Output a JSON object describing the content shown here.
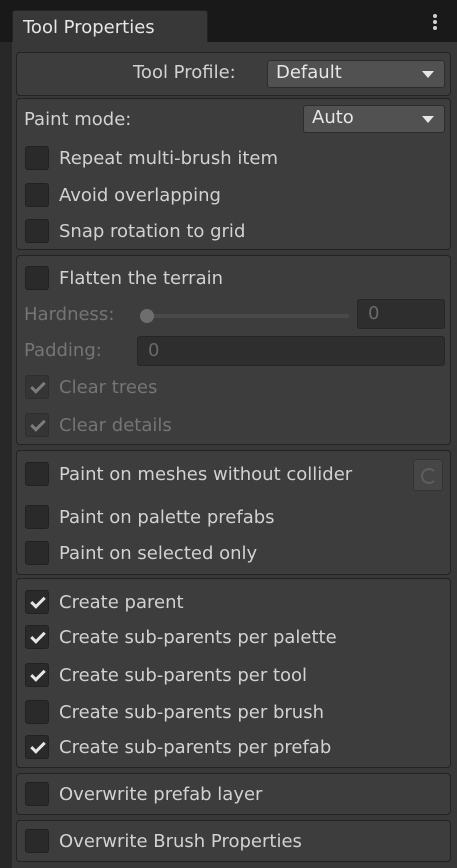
{
  "window": {
    "tab_title": "Tool Properties",
    "menu_icon": "vertical-dots-icon"
  },
  "profile": {
    "label": "Tool Profile:",
    "value": "Default"
  },
  "paint_group": {
    "mode_label": "Paint mode:",
    "mode_value": "Auto",
    "options": [
      {
        "label": "Repeat multi-brush item",
        "checked": false
      },
      {
        "label": "Avoid overlapping",
        "checked": false
      },
      {
        "label": "Snap rotation to grid",
        "checked": false
      }
    ]
  },
  "terrain_group": {
    "flatten_label": "Flatten the terrain",
    "flatten_checked": false,
    "hardness_label": "Hardness:",
    "hardness_value": "0",
    "padding_label": "Padding:",
    "padding_value": "0",
    "clear_trees_label": "Clear trees",
    "clear_trees_checked": true,
    "clear_details_label": "Clear details",
    "clear_details_checked": true
  },
  "mesh_group": {
    "options": [
      {
        "label": "Paint on meshes without collider",
        "checked": false
      },
      {
        "label": "Paint on palette prefabs",
        "checked": false
      },
      {
        "label": "Paint on selected only",
        "checked": false
      }
    ],
    "refresh_icon": "refresh-icon"
  },
  "parent_group": {
    "options": [
      {
        "label": "Create parent",
        "checked": true
      },
      {
        "label": "Create sub-parents per palette",
        "checked": true
      },
      {
        "label": "Create sub-parents per tool",
        "checked": true
      },
      {
        "label": "Create sub-parents per brush",
        "checked": false
      },
      {
        "label": "Create sub-parents per prefab",
        "checked": true
      }
    ]
  },
  "layer_group": {
    "label": "Overwrite prefab layer",
    "checked": false
  },
  "brush_group": {
    "label": "Overwrite Brush Properties",
    "checked": false
  },
  "colors": {
    "background": "#383838",
    "group_background": "#3d3d3d",
    "text": "#d2d2d2",
    "disabled_text": "#757575"
  }
}
